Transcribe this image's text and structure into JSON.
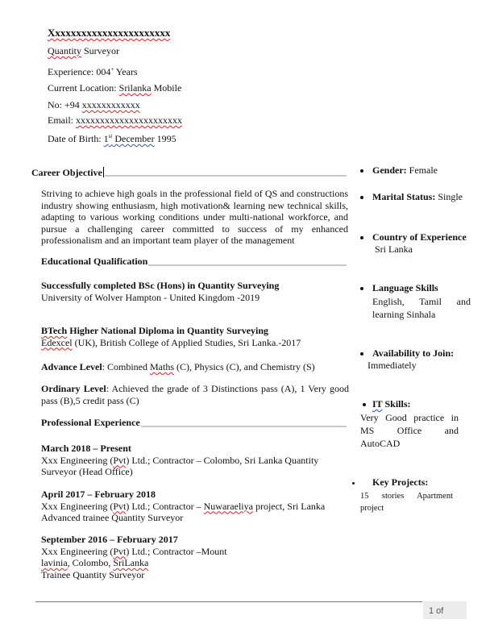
{
  "header": {
    "name": "Xxxxxxxxxxxxxxxxxxxxxxx",
    "title_word1": "Quantity",
    "title_word2": " Surveyor",
    "experience_label": "Experience: ",
    "experience_value": "004",
    "experience_sup": "+",
    "experience_unit": " Years",
    "location_label": "Current Location: ",
    "location_value": "Srilanka",
    "mobile_label": " Mobile",
    "phone_label": "No: +94 ",
    "phone_value": "xxxxxxxxxxxx",
    "email_label": "Email: ",
    "email_value": "xxxxxxxxxxxxxxxxxxxxxx",
    "dob_label": "Date of Birth: ",
    "dob_day": "1",
    "dob_day_sup": "st",
    "dob_month": " December",
    "dob_year": " 1995"
  },
  "career_objective": {
    "title": "Career Objective",
    "text": "Striving to achieve high goals in the professional field of QS and constructions industry showing enthusiasm, high motivation& learning new technical skills, adapting to various working conditions under multi-national workforce, and pursue a challenging career committed to success of my enhanced professionalism and an important team player of the management"
  },
  "education": {
    "title": "Educational Qualification",
    "bsc_title": "Successfully completed BSc (Hons) in Quantity Surveying",
    "bsc_detail": "University of Wolver Hampton - United Kingdom -2019",
    "btech_title_word": "BTech",
    "btech_title_rest": " Higher National Diploma in Quantity Surveying",
    "btech_detail_word": "Edexcel",
    "btech_detail_rest": " (UK), British College of Applied Studies, Sri Lanka.-2017",
    "al_label": "Advance Level",
    "al_text1": ": Combined ",
    "al_maths": "Maths",
    "al_text2": " (C), Physics (C), and Chemistry (S)",
    "ol_label": "Ordinary Level",
    "ol_text": ": Achieved the grade of 3 Distinctions pass (A), 1 Very good pass (B),5 credit pass (C)"
  },
  "experience": {
    "title": "Professional Experience",
    "jobs": [
      {
        "period": "March 2018 – Present",
        "company_a": "Xxx Engineering (",
        "company_pvt": "Pvt",
        "company_b": ") Ltd.; Contractor – Colombo, Sri Lanka Quantity",
        "role": "Surveyor (Head Office)"
      },
      {
        "period": "April 2017 – February 2018",
        "company_a": "Xxx Engineering (",
        "company_pvt": "Pvt",
        "company_b": ") Ltd.; Contractor – ",
        "company_place": "Nuwaraeliya",
        "company_c": " project, Sri Lanka",
        "role": "Advanced trainee Quantity Surveyor"
      },
      {
        "period": "September 2016 – February 2017",
        "company_a": "Xxx Engineering (",
        "company_pvt": "Pvt",
        "company_b": ") Ltd.; Contractor –Mount",
        "loc_word1": "lavinia",
        "loc_mid": ", Colombo, ",
        "loc_word2": "SriLanka",
        "role": "Trainee Quantity Surveyor"
      }
    ]
  },
  "sidebar": {
    "gender_label": "Gender:",
    "gender_value": " Female",
    "marital_label": "Marital Status:",
    "marital_value": " Single",
    "country_label": "Country of Experience",
    "country_value": "Sri Lanka",
    "language_label": "Language Skills",
    "language_value": "English, Tamil and learning Sinhala",
    "availability_label": "Availability to Join:",
    "availability_value": "Immediately",
    "it_label_word": "IT",
    "it_label_rest": " Skills:",
    "it_value": "Very Good practice in MS Office and AutoCAD",
    "projects_label": "Key Projects:",
    "projects_value": "15 stories Apartment project"
  },
  "footer": {
    "page_indicator": "1 of"
  }
}
